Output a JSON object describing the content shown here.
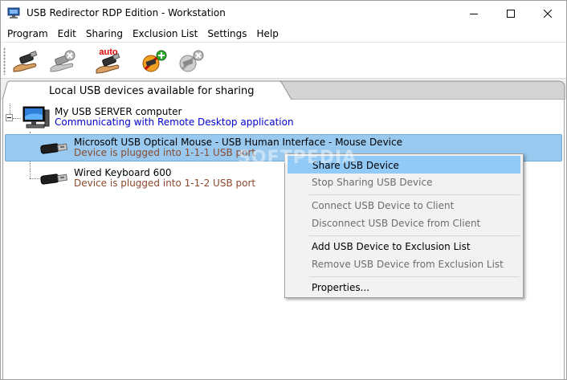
{
  "window": {
    "title": "USB Redirector RDP Edition - Workstation"
  },
  "menu": {
    "items": [
      "Program",
      "Edit",
      "Sharing",
      "Exclusion List",
      "Settings",
      "Help"
    ]
  },
  "toolbar": {
    "buttons": [
      {
        "icon": "share-usb-icon"
      },
      {
        "icon": "stop-sharing-usb-icon"
      },
      {
        "icon": "auto-share-icon",
        "badge": "auto"
      },
      {
        "icon": "add-exclusion-icon"
      },
      {
        "icon": "remove-exclusion-icon"
      }
    ]
  },
  "tabs": {
    "active_label": "Local USB devices available for sharing"
  },
  "tree": {
    "computer": {
      "name": "My USB SERVER computer",
      "status": "Communicating with Remote Desktop application"
    },
    "devices": [
      {
        "name": "Microsoft USB Optical Mouse - USB Human Interface - Mouse Device",
        "port": "Device is plugged into 1-1-1 USB port",
        "selected": true
      },
      {
        "name": "Wired Keyboard 600",
        "port": "Device is plugged into 1-1-2 USB port",
        "selected": false
      }
    ]
  },
  "context_menu": {
    "items": [
      {
        "label": "Share USB Device",
        "enabled": true,
        "highlighted": true
      },
      {
        "label": "Stop Sharing USB Device",
        "enabled": false
      },
      {
        "label": "Connect USB Device to Client",
        "enabled": false
      },
      {
        "label": "Disconnect USB Device from Client",
        "enabled": false
      },
      {
        "label": "Add USB Device to Exclusion List",
        "enabled": true
      },
      {
        "label": "Remove USB Device from Exclusion List",
        "enabled": false
      },
      {
        "label": "Properties...",
        "enabled": true
      }
    ]
  },
  "watermark": "SOFTPEDIA",
  "colors": {
    "selection": "#99c9ef",
    "menu_highlight": "#91c9f7",
    "computer_status": "#0000cc",
    "device_port": "#8b4a2e"
  }
}
